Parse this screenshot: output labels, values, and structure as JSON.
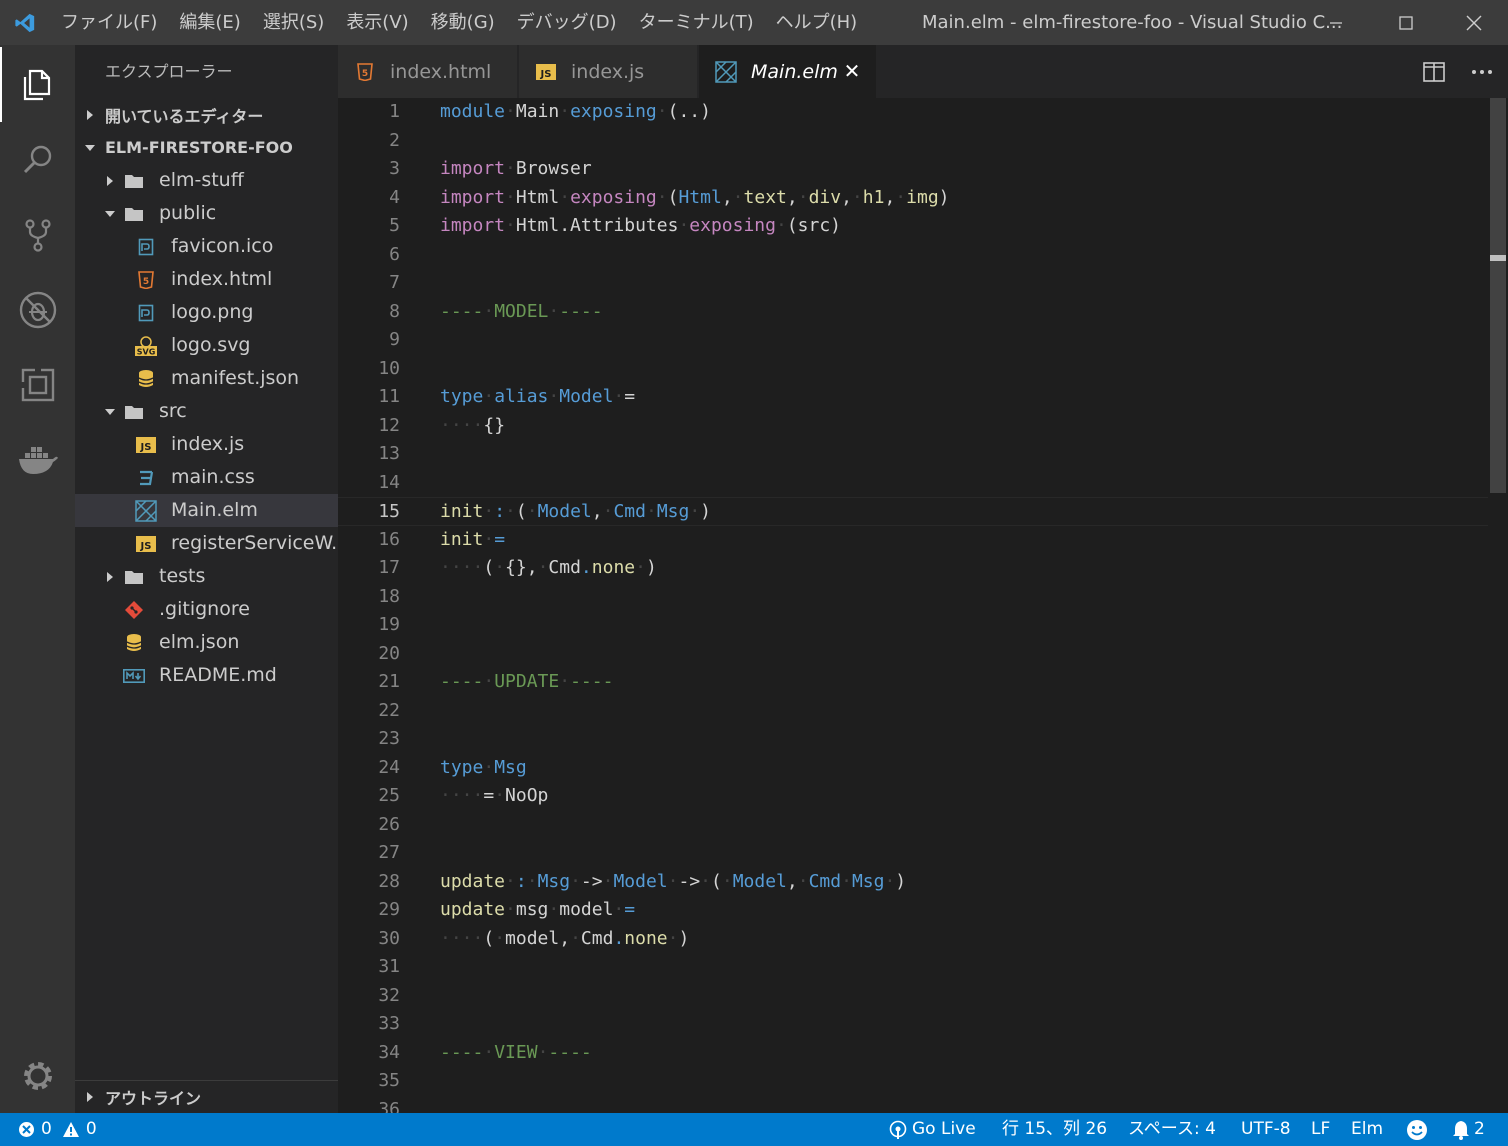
{
  "titlebar": {
    "menu": [
      "ファイル(F)",
      "編集(E)",
      "選択(S)",
      "表示(V)",
      "移動(G)",
      "デバッグ(D)",
      "ターミナル(T)",
      "ヘルプ(H)"
    ],
    "window_title": "Main.elm - elm-firestore-foo - Visual Studio C..."
  },
  "activitybar": {
    "items": [
      "explorer-icon",
      "search-icon",
      "source-control-icon",
      "debug-icon",
      "extensions-icon",
      "docker-icon"
    ],
    "settings": "gear-icon"
  },
  "sidebar": {
    "title": "エクスプローラー",
    "open_editors": "開いているエディター",
    "project": "ELM-FIRESTORE-FOO",
    "tree": [
      {
        "label": "elm-stuff",
        "type": "folder",
        "expanded": false,
        "depth": 0
      },
      {
        "label": "public",
        "type": "folder",
        "expanded": true,
        "depth": 0
      },
      {
        "label": "favicon.ico",
        "type": "image",
        "depth": 1
      },
      {
        "label": "index.html",
        "type": "html",
        "depth": 1
      },
      {
        "label": "logo.png",
        "type": "image",
        "depth": 1
      },
      {
        "label": "logo.svg",
        "type": "svg",
        "depth": 1
      },
      {
        "label": "manifest.json",
        "type": "json",
        "depth": 1
      },
      {
        "label": "src",
        "type": "folder",
        "expanded": true,
        "depth": 0
      },
      {
        "label": "index.js",
        "type": "js",
        "depth": 1
      },
      {
        "label": "main.css",
        "type": "css",
        "depth": 1
      },
      {
        "label": "Main.elm",
        "type": "elm",
        "depth": 1,
        "selected": true
      },
      {
        "label": "registerServiceW...",
        "type": "js",
        "depth": 1
      },
      {
        "label": "tests",
        "type": "folder",
        "expanded": false,
        "depth": 0
      },
      {
        "label": ".gitignore",
        "type": "git",
        "depth": 0
      },
      {
        "label": "elm.json",
        "type": "json",
        "depth": 0
      },
      {
        "label": "README.md",
        "type": "markdown",
        "depth": 0
      }
    ],
    "outline": "アウトライン"
  },
  "tabs": [
    {
      "label": "index.html",
      "type": "html",
      "active": false
    },
    {
      "label": "index.js",
      "type": "js",
      "active": false
    },
    {
      "label": "Main.elm",
      "type": "elm",
      "active": true
    }
  ],
  "editor": {
    "current_line": 15,
    "lines": [
      {
        "n": "1",
        "tokens": [
          [
            "kw2",
            "module"
          ],
          [
            "ws",
            "·"
          ],
          [
            "",
            "Main"
          ],
          [
            "ws",
            "·"
          ],
          [
            "kw2",
            "exposing"
          ],
          [
            "ws",
            "·"
          ],
          [
            "",
            "(..)"
          ]
        ]
      },
      {
        "n": "2",
        "tokens": []
      },
      {
        "n": "3",
        "tokens": [
          [
            "kw",
            "import"
          ],
          [
            "ws",
            "·"
          ],
          [
            "",
            "Browser"
          ]
        ]
      },
      {
        "n": "4",
        "tokens": [
          [
            "kw",
            "import"
          ],
          [
            "ws",
            "·"
          ],
          [
            "",
            "Html"
          ],
          [
            "ws",
            "·"
          ],
          [
            "kw",
            "exposing"
          ],
          [
            "ws",
            "·"
          ],
          [
            "",
            "("
          ],
          [
            "ty2",
            "Html"
          ],
          [
            "",
            ","
          ],
          [
            "ws",
            "·"
          ],
          [
            "fn",
            "text"
          ],
          [
            "",
            ","
          ],
          [
            "ws",
            "·"
          ],
          [
            "fn",
            "div"
          ],
          [
            "",
            ","
          ],
          [
            "ws",
            "·"
          ],
          [
            "fn",
            "h1"
          ],
          [
            "",
            ","
          ],
          [
            "ws",
            "·"
          ],
          [
            "fn",
            "img"
          ],
          [
            "",
            ")"
          ]
        ]
      },
      {
        "n": "5",
        "tokens": [
          [
            "kw",
            "import"
          ],
          [
            "ws",
            "·"
          ],
          [
            "",
            "Html.Attributes"
          ],
          [
            "ws",
            "·"
          ],
          [
            "kw",
            "exposing"
          ],
          [
            "ws",
            "·"
          ],
          [
            "",
            "(src)"
          ]
        ]
      },
      {
        "n": "6",
        "tokens": []
      },
      {
        "n": "7",
        "tokens": []
      },
      {
        "n": "8",
        "tokens": [
          [
            "cm",
            "----"
          ],
          [
            "ws",
            "·"
          ],
          [
            "cm",
            "MODEL"
          ],
          [
            "ws",
            "·"
          ],
          [
            "cm",
            "----"
          ]
        ]
      },
      {
        "n": "9",
        "tokens": []
      },
      {
        "n": "10",
        "tokens": []
      },
      {
        "n": "11",
        "tokens": [
          [
            "kw2",
            "type"
          ],
          [
            "ws",
            "·"
          ],
          [
            "kw2",
            "alias"
          ],
          [
            "ws",
            "·"
          ],
          [
            "ty2",
            "Model"
          ],
          [
            "ws",
            "·"
          ],
          [
            "",
            "="
          ]
        ]
      },
      {
        "n": "12",
        "tokens": [
          [
            "ws",
            "····"
          ],
          [
            "",
            "{}"
          ]
        ]
      },
      {
        "n": "13",
        "tokens": []
      },
      {
        "n": "14",
        "tokens": []
      },
      {
        "n": "15",
        "tokens": [
          [
            "fn",
            "init"
          ],
          [
            "ws",
            "·"
          ],
          [
            "kw2",
            ":"
          ],
          [
            "ws",
            "·"
          ],
          [
            "",
            "("
          ],
          [
            "ws",
            "·"
          ],
          [
            "ty2",
            "Model"
          ],
          [
            "",
            ","
          ],
          [
            "ws",
            "·"
          ],
          [
            "ty2",
            "Cmd"
          ],
          [
            "ws",
            "·"
          ],
          [
            "ty2",
            "Msg"
          ],
          [
            "ws",
            "·"
          ],
          [
            "",
            ")"
          ]
        ]
      },
      {
        "n": "16",
        "tokens": [
          [
            "fn",
            "init"
          ],
          [
            "ws",
            "·"
          ],
          [
            "kw2",
            "="
          ]
        ]
      },
      {
        "n": "17",
        "tokens": [
          [
            "ws",
            "····"
          ],
          [
            "",
            "("
          ],
          [
            "ws",
            "·"
          ],
          [
            "",
            "{},"
          ],
          [
            "ws",
            "·"
          ],
          [
            "",
            "Cmd"
          ],
          [
            "kw2",
            "."
          ],
          [
            "fn",
            "none"
          ],
          [
            "ws",
            "·"
          ],
          [
            "",
            ")"
          ]
        ]
      },
      {
        "n": "18",
        "tokens": []
      },
      {
        "n": "19",
        "tokens": []
      },
      {
        "n": "20",
        "tokens": []
      },
      {
        "n": "21",
        "tokens": [
          [
            "cm",
            "----"
          ],
          [
            "ws",
            "·"
          ],
          [
            "cm",
            "UPDATE"
          ],
          [
            "ws",
            "·"
          ],
          [
            "cm",
            "----"
          ]
        ]
      },
      {
        "n": "22",
        "tokens": []
      },
      {
        "n": "23",
        "tokens": []
      },
      {
        "n": "24",
        "tokens": [
          [
            "kw2",
            "type"
          ],
          [
            "ws",
            "·"
          ],
          [
            "ty2",
            "Msg"
          ]
        ]
      },
      {
        "n": "25",
        "tokens": [
          [
            "ws",
            "····"
          ],
          [
            "",
            "="
          ],
          [
            "ws",
            "·"
          ],
          [
            "",
            "NoOp"
          ]
        ]
      },
      {
        "n": "26",
        "tokens": []
      },
      {
        "n": "27",
        "tokens": []
      },
      {
        "n": "28",
        "tokens": [
          [
            "fn",
            "update"
          ],
          [
            "ws",
            "·"
          ],
          [
            "kw2",
            ":"
          ],
          [
            "ws",
            "·"
          ],
          [
            "ty2",
            "Msg"
          ],
          [
            "ws",
            "·"
          ],
          [
            "",
            "->"
          ],
          [
            "ws",
            "·"
          ],
          [
            "ty2",
            "Model"
          ],
          [
            "ws",
            "·"
          ],
          [
            "",
            "->"
          ],
          [
            "ws",
            "·"
          ],
          [
            "",
            "("
          ],
          [
            "ws",
            "·"
          ],
          [
            "ty2",
            "Model"
          ],
          [
            "",
            ","
          ],
          [
            "ws",
            "·"
          ],
          [
            "ty2",
            "Cmd"
          ],
          [
            "ws",
            "·"
          ],
          [
            "ty2",
            "Msg"
          ],
          [
            "ws",
            "·"
          ],
          [
            "",
            ")"
          ]
        ]
      },
      {
        "n": "29",
        "tokens": [
          [
            "fn",
            "update"
          ],
          [
            "ws",
            "·"
          ],
          [
            "",
            "msg"
          ],
          [
            "ws",
            "·"
          ],
          [
            "",
            "model"
          ],
          [
            "ws",
            "·"
          ],
          [
            "kw2",
            "="
          ]
        ]
      },
      {
        "n": "30",
        "tokens": [
          [
            "ws",
            "····"
          ],
          [
            "",
            "("
          ],
          [
            "ws",
            "·"
          ],
          [
            "",
            "model,"
          ],
          [
            "ws",
            "·"
          ],
          [
            "",
            "Cmd"
          ],
          [
            "kw2",
            "."
          ],
          [
            "fn",
            "none"
          ],
          [
            "ws",
            "·"
          ],
          [
            "",
            ")"
          ]
        ]
      },
      {
        "n": "31",
        "tokens": []
      },
      {
        "n": "32",
        "tokens": []
      },
      {
        "n": "33",
        "tokens": []
      },
      {
        "n": "34",
        "tokens": [
          [
            "cm",
            "----"
          ],
          [
            "ws",
            "·"
          ],
          [
            "cm",
            "VIEW"
          ],
          [
            "ws",
            "·"
          ],
          [
            "cm",
            "----"
          ]
        ]
      },
      {
        "n": "35",
        "tokens": []
      },
      {
        "n": "36",
        "tokens": []
      }
    ]
  },
  "statusbar": {
    "errors": "0",
    "warnings": "0",
    "go_live": "Go Live",
    "position": "行 15、列 26",
    "spaces": "スペース: 4",
    "encoding": "UTF-8",
    "eol": "LF",
    "language": "Elm",
    "notifications": "2"
  }
}
